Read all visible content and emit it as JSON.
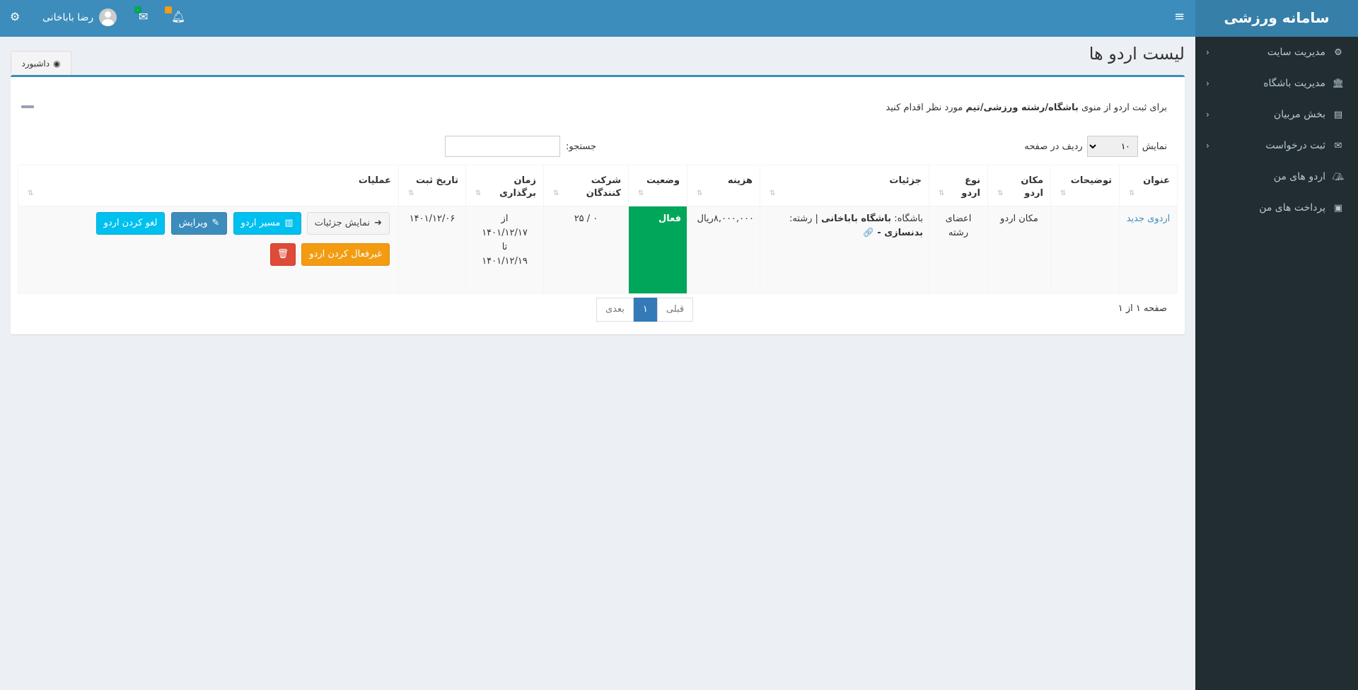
{
  "app": {
    "title": "سامانه ورزشی"
  },
  "header": {
    "user_name": "رضا باباخانی",
    "notif_badge": "۰",
    "mail_badge": "۰",
    "colors": {
      "notif": "#f39c12",
      "mail": "#00a65a"
    }
  },
  "sidebar": {
    "items": [
      {
        "label": "مدیریت سایت",
        "icon": "cogs-icon",
        "has_children": true
      },
      {
        "label": "مدیریت باشگاه",
        "icon": "bank-icon",
        "has_children": true
      },
      {
        "label": "بخش مربیان",
        "icon": "id-card-icon",
        "has_children": true
      },
      {
        "label": "ثبت درخواست",
        "icon": "envelope-icon",
        "has_children": true
      },
      {
        "label": "اردو های من",
        "icon": "campground-icon",
        "has_children": false
      },
      {
        "label": "پرداخت های من",
        "icon": "money-icon",
        "has_children": false
      }
    ]
  },
  "page": {
    "title": "لیست اردو ها",
    "tab": "داشبورد"
  },
  "note": {
    "pre": "برای ثبت اردو از منوی ",
    "bold": "باشگاه/رشته ورزشی/تیم",
    "post": " مورد نظر اقدام کنید"
  },
  "controls": {
    "show": "نمایش",
    "page_size": "۱۰",
    "rows_per_page": "ردیف در صفحه",
    "search_label": "جستجو:",
    "search_value": ""
  },
  "table": {
    "headers": [
      "عنوان",
      "توضیحات",
      "مکان اردو",
      "نوع اردو",
      "جزئیات",
      "هزینه",
      "وضعیت",
      "شرکت کنندگان",
      "زمان برگذاری",
      "تاریخ ثبت",
      "عملیات"
    ],
    "rows": [
      {
        "title": "اردوی جدید",
        "description": "",
        "location": "مکان اردو",
        "type": "اعضای رشته",
        "details_club_label": "باشگاه:",
        "details_club": "باشگاه باباخانی",
        "details_field_label": "| رشته:",
        "details_field": "بدنسازی -",
        "cost": "۸,۰۰۰,۰۰۰ریال",
        "status": "فعال",
        "participants": "۰ / ۲۵",
        "time_from": "از",
        "date_from": "۱۴۰۱/۱۲/۱۷",
        "time_to": "تا",
        "date_to": "۱۴۰۱/۱۲/۱۹",
        "registered": "۱۴۰۱/۱۲/۰۶",
        "actions": {
          "details": "نمایش جزئیات",
          "route": "مسیر اردو",
          "edit": "ویرایش",
          "cancel": "لغو کردن اردو",
          "deactivate": "غیرفعال کردن اردو"
        }
      }
    ]
  },
  "pagination": {
    "prev": "قبلی",
    "current": "۱",
    "next": "بعدی",
    "info": "صفحه ۱ از ۱"
  }
}
